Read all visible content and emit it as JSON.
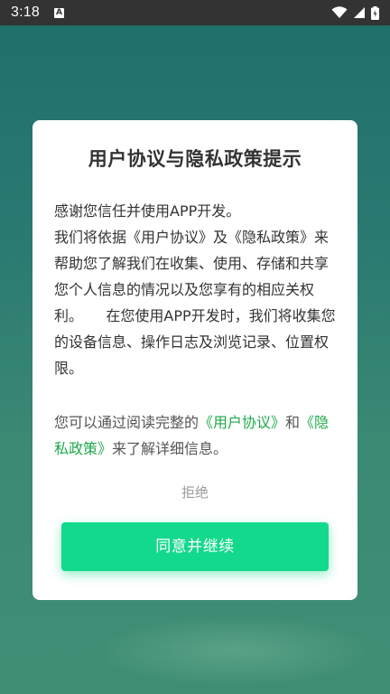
{
  "status_bar": {
    "time": "3:18",
    "notification_glyph": "A",
    "icons": [
      "wifi-icon",
      "signal-icon",
      "battery-icon"
    ]
  },
  "dialog": {
    "title": "用户协议与隐私政策提示",
    "body_intro": "感谢您信任并使用APP开发。",
    "body_detail": "我们将依据《用户协议》及《隐私政策》来帮助您了解我们在收集、使用、存储和共享您个人信息的情况以及您享有的相应关权利。     在您使用APP开发时，我们将收集您的设备信息、操作日志及浏览记录、位置权限。",
    "notice_prefix": "您可以通过阅读完整的",
    "user_agreement_link": "《用户协议》",
    "notice_and": "和",
    "privacy_policy_link": "《隐私政策》",
    "notice_suffix": "来了解详细信息。",
    "reject_label": "拒绝",
    "agree_label": "同意并继续"
  },
  "colors": {
    "accent": "#13d98c",
    "link": "#1fa84a",
    "background_top": "#1f6e6a",
    "background_bottom": "#3f8e74"
  }
}
